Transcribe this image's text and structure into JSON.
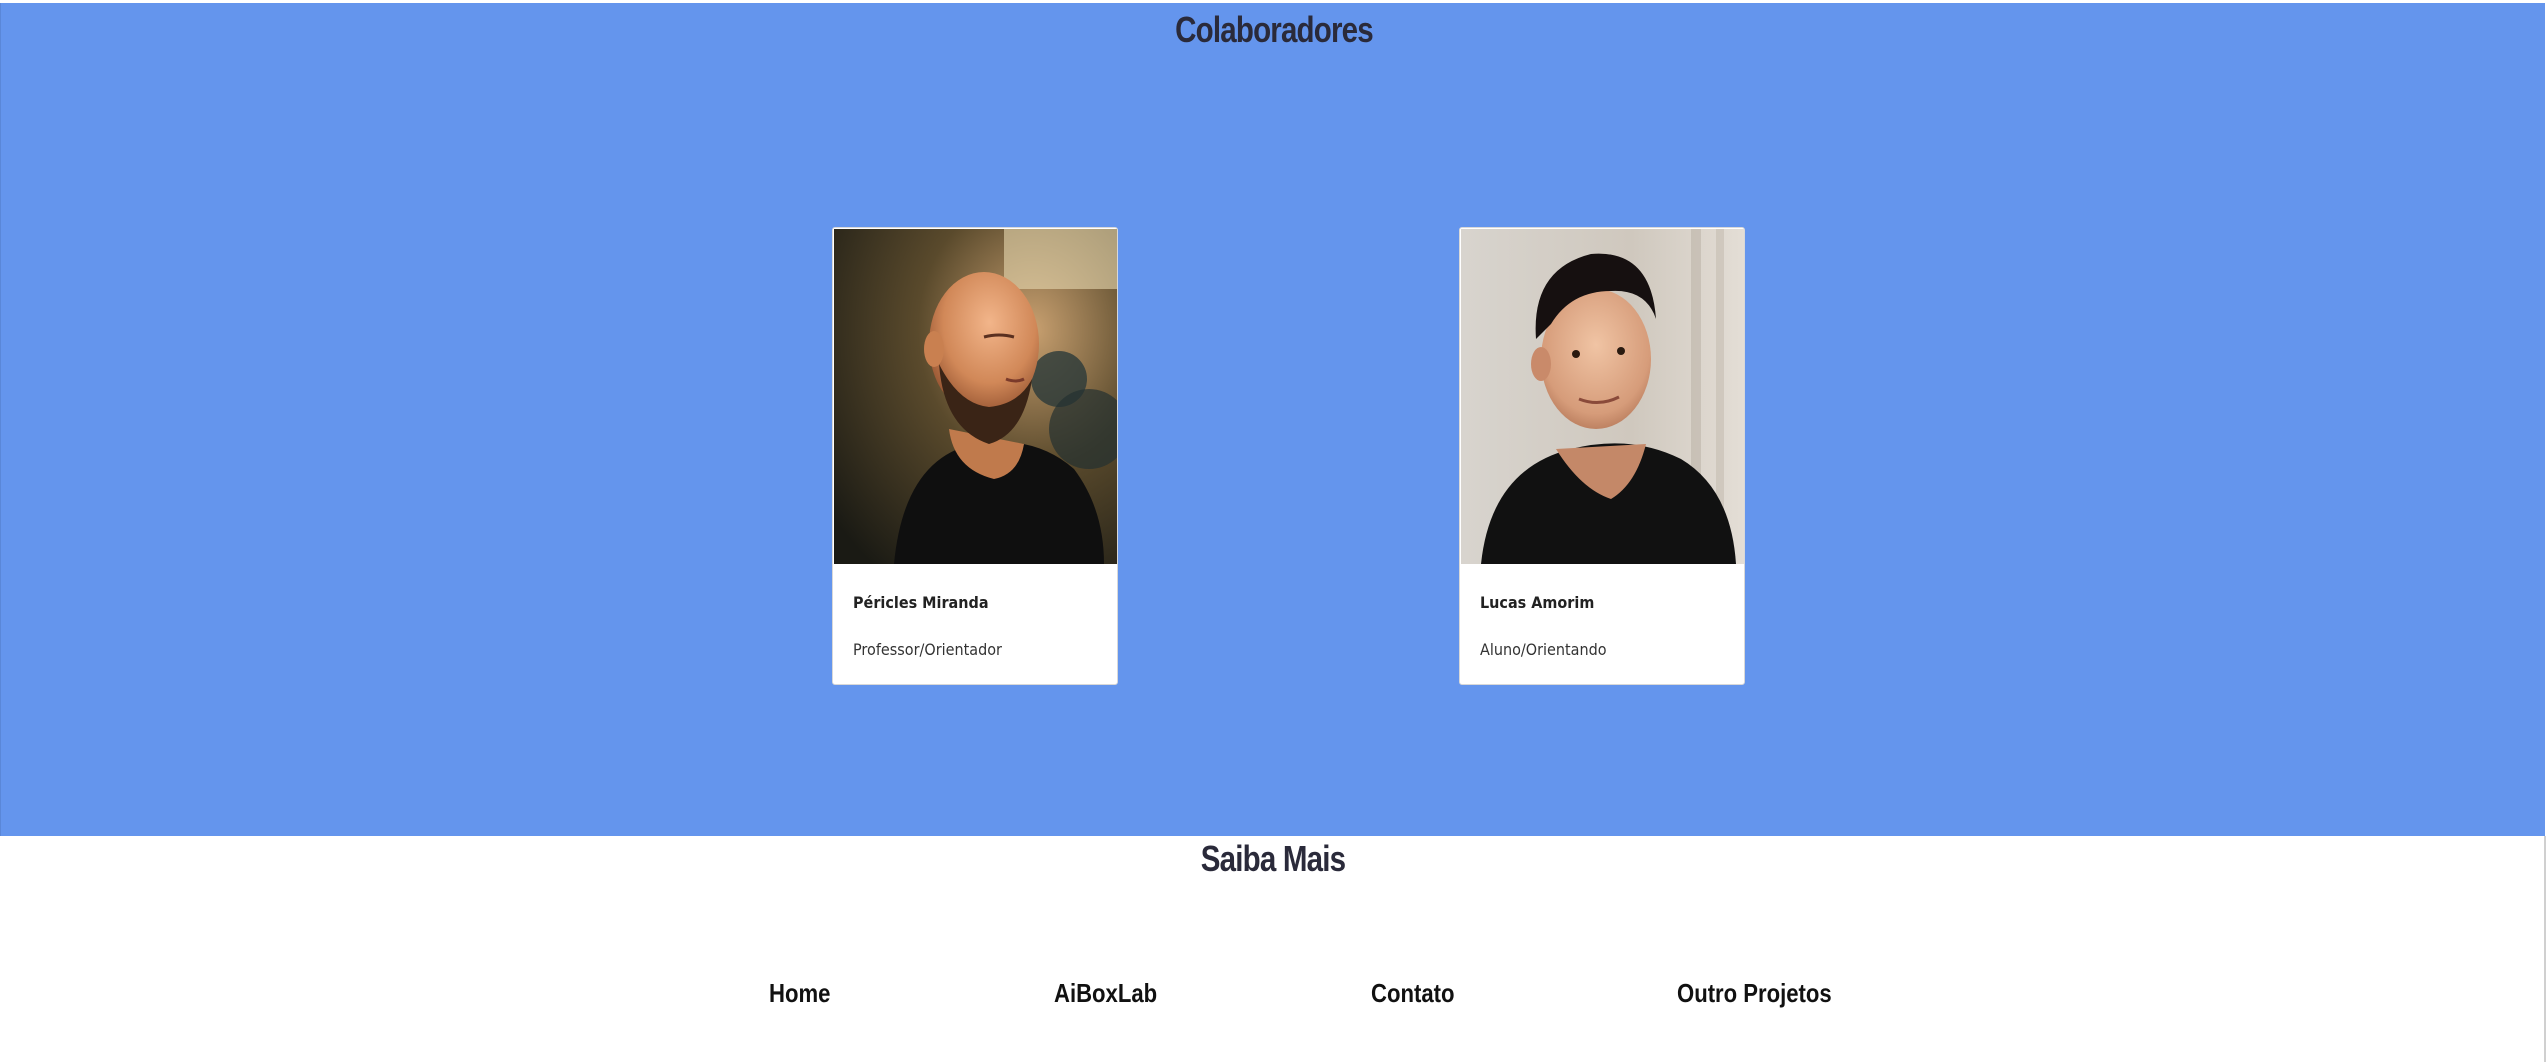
{
  "collaborators": {
    "title": "Colaboradores",
    "people": [
      {
        "name": "Péricles Miranda",
        "role": "Professor/Orientador",
        "photo": "portrait-bald-bearded-man"
      },
      {
        "name": "Lucas Amorim",
        "role": "Aluno/Orientando",
        "photo": "portrait-young-man-dark-hair"
      }
    ]
  },
  "saiba_mais": {
    "title": "Saiba Mais",
    "links": [
      "Home",
      "AiBoxLab",
      "Contato",
      "Outro Projetos"
    ]
  },
  "colors": {
    "section_background": "#6495ed",
    "title_text": "#2a2a3a",
    "card_background": "#ffffff"
  }
}
